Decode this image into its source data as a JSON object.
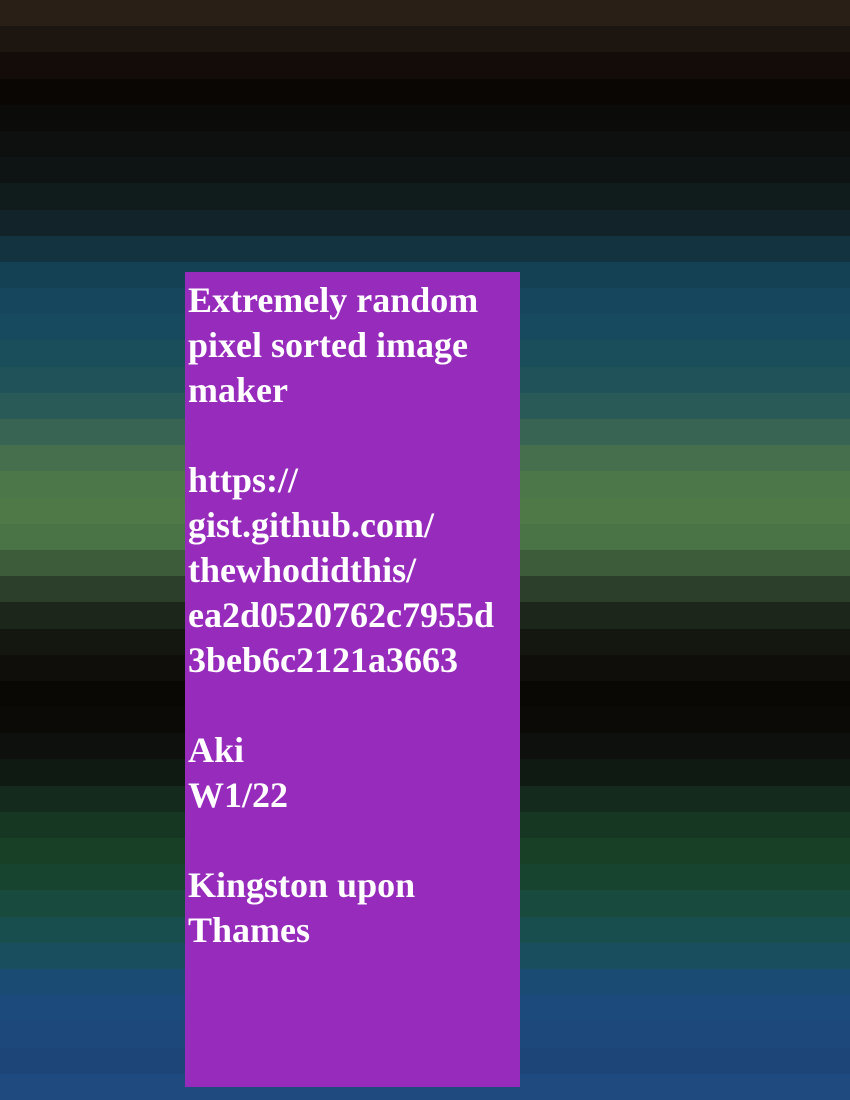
{
  "background": {
    "stripe_colors": [
      "#2a1f16",
      "#1d150f",
      "#130c08",
      "#0a0604",
      "#0b0b09",
      "#0d100e",
      "#0e1414",
      "#101b1c",
      "#12242a",
      "#133341",
      "#154154",
      "#15465e",
      "#174a5e",
      "#1a4e5b",
      "#1f5359",
      "#2a5a58",
      "#386453",
      "#456f4d",
      "#4c7849",
      "#4f7a47",
      "#4b7446",
      "#3c5c3a",
      "#2b3f2a",
      "#1d261b",
      "#141710",
      "#100e0a",
      "#0a0805",
      "#0b0a07",
      "#0d100c",
      "#0f1a13",
      "#132a1c",
      "#163823",
      "#174026",
      "#17442e",
      "#184a3e",
      "#184e4e",
      "#194e5e",
      "#1a4b72",
      "#1c4a7d",
      "#1d487c",
      "#1e4577",
      "#1f4a80"
    ]
  },
  "panel": {
    "color": "#962bbc",
    "lines": [
      "Extremely random",
      "pixel sorted image",
      "maker",
      "",
      "https://",
      "gist.github.com/",
      "thewhodidthis/",
      "ea2d0520762c7955d",
      "3beb6c2121a3663",
      "",
      "Aki",
      "W1/22",
      "",
      "Kingston upon",
      "Thames"
    ]
  }
}
